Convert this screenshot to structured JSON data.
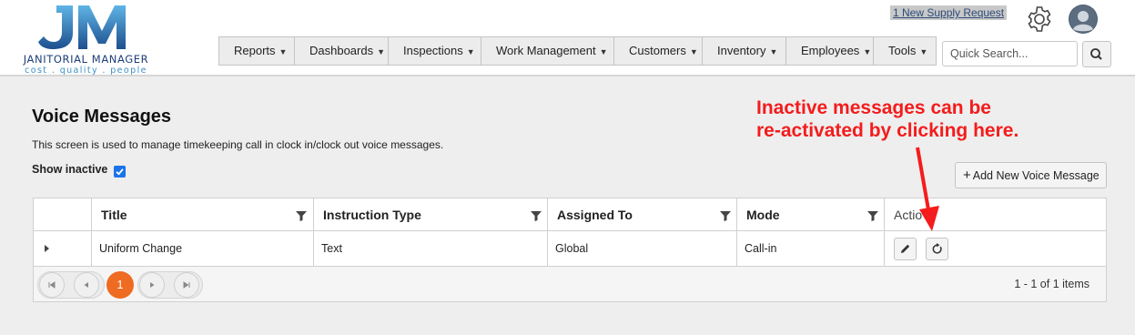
{
  "app": {
    "logo_text": "JANITORIAL MANAGER",
    "logo_tagline": "cost . quality . people",
    "logo_letters": "JM"
  },
  "header": {
    "supply_link": "1 New Supply Request",
    "icons": [
      "gear-icon",
      "user-avatar-icon"
    ],
    "search_placeholder": "Quick Search..."
  },
  "nav": {
    "items": [
      {
        "label": "Reports"
      },
      {
        "label": "Dashboards"
      },
      {
        "label": "Inspections"
      },
      {
        "label": "Work Management"
      },
      {
        "label": "Customers"
      },
      {
        "label": "Inventory"
      },
      {
        "label": "Employees"
      },
      {
        "label": "Tools"
      }
    ]
  },
  "page": {
    "title": "Voice Messages",
    "description": "This screen is used to manage timekeeping call in clock in/clock out voice messages.",
    "show_inactive_label": "Show inactive",
    "show_inactive_checked": true,
    "add_button_label": "Add New Voice Message"
  },
  "grid": {
    "columns": [
      "Title",
      "Instruction Type",
      "Assigned To",
      "Mode",
      "Actio"
    ],
    "rows": [
      {
        "title": "Uniform Change",
        "instruction_type": "Text",
        "assigned_to": "Global",
        "mode": "Call-in"
      }
    ],
    "pager": {
      "current_page": "1",
      "info": "1 - 1 of 1 items"
    }
  },
  "annotation": {
    "line1": "Inactive messages can be",
    "line2": "re-activated by clicking here.",
    "color": "#f41c1c"
  },
  "colors": {
    "accent": "#ef6b21",
    "brand": "#1d3f78",
    "checkbox": "#1a73e8"
  }
}
